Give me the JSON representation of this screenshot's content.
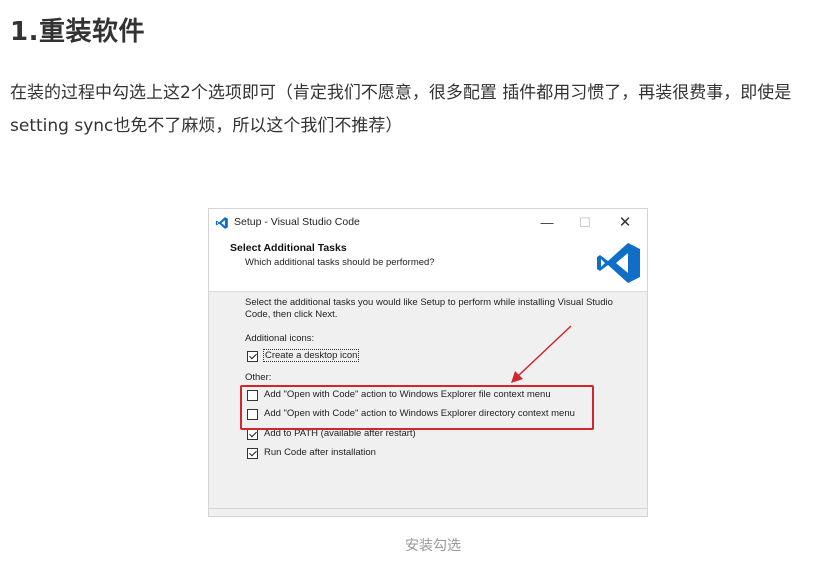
{
  "article": {
    "heading": "1.重装软件",
    "paragraph": "在装的过程中勾选上这2个选项即可（肯定我们不愿意，很多配置 插件都用习惯了，再装很费事，即使是setting sync也免不了麻烦，所以这个我们不推荐）",
    "caption": "安装勾选"
  },
  "setup_dialog": {
    "title": "Setup - Visual Studio Code",
    "window_buttons": {
      "minimize": "—",
      "maximize": "☐",
      "close": "✕"
    },
    "header_title": "Select Additional Tasks",
    "header_subtitle": "Which additional tasks should be performed?",
    "intro": "Select the additional tasks you would like Setup to perform while installing Visual Studio Code, then click Next.",
    "additional_icons_label": "Additional icons:",
    "other_label": "Other:",
    "options": [
      {
        "label": "Create a desktop icon",
        "checked": true
      },
      {
        "label": "Add \"Open with Code\" action to Windows Explorer file context menu",
        "checked": false
      },
      {
        "label": "Add \"Open with Code\" action to Windows Explorer directory context menu",
        "checked": false
      },
      {
        "label": "Add to PATH (available after restart)",
        "checked": true
      },
      {
        "label": "Run Code after installation",
        "checked": true
      }
    ]
  },
  "colors": {
    "highlight": "#d0262d",
    "vscode_blue": "#0f6fc6"
  },
  "icons": {
    "app": "vscode-icon",
    "logo": "vscode-logo-icon"
  }
}
